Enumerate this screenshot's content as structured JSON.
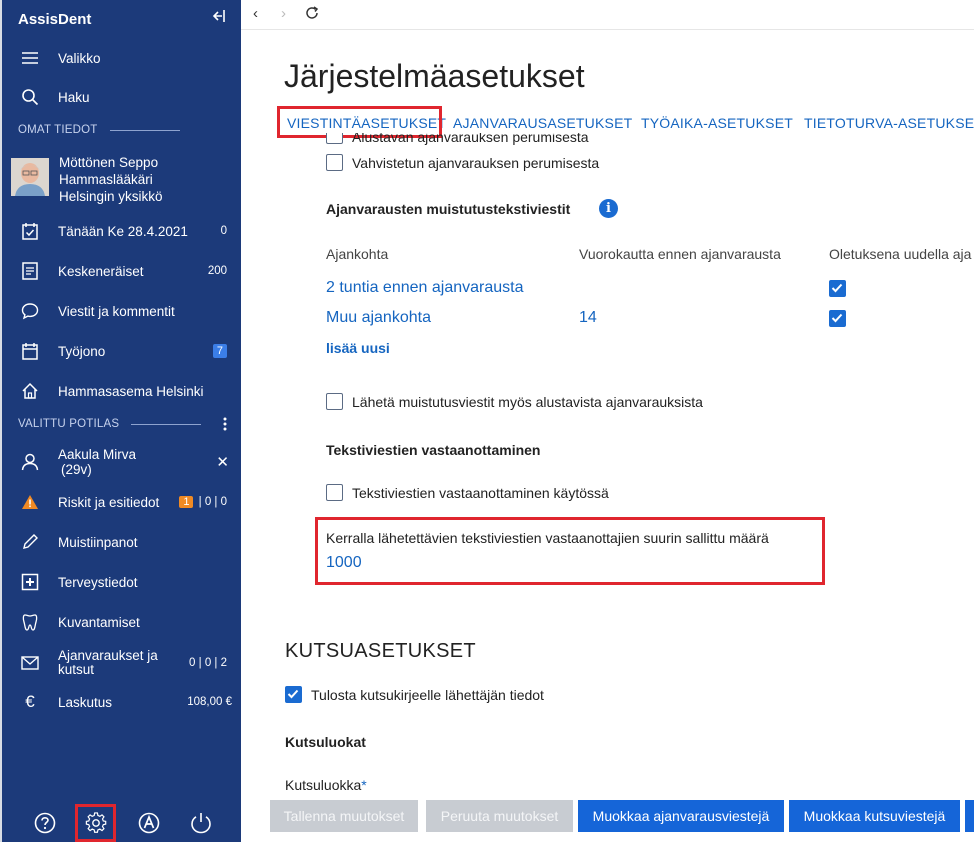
{
  "sidebar": {
    "brand": "AssisDent",
    "menu_label": "Valikko",
    "search_label": "Haku",
    "own_section": "OMAT TIEDOT",
    "profile": {
      "name": "Möttönen Seppo",
      "role": "Hammaslääkäri",
      "unit": "Helsingin yksikkö"
    },
    "items": [
      {
        "label": "Tänään Ke 28.4.2021",
        "count": "0"
      },
      {
        "label": "Keskeneräiset",
        "count": "200"
      },
      {
        "label": "Viestit ja kommentit",
        "count": ""
      },
      {
        "label": "Työjono",
        "count": "7"
      },
      {
        "label": "Hammasasema Helsinki",
        "count": ""
      }
    ],
    "patient_section": "VALITTU POTILAS",
    "patient": {
      "name": "Aakula Mirva",
      "age": "(29v)"
    },
    "patient_items": [
      {
        "label": "Riskit ja esitiedot",
        "badge": "1",
        "count": "| 0 | 0"
      },
      {
        "label": "Muistiinpanot",
        "count": ""
      },
      {
        "label": "Terveystiedot",
        "count": ""
      },
      {
        "label": "Kuvantamiset",
        "count": ""
      },
      {
        "label": "Ajanvaraukset ja kutsut",
        "count": "0 | 0 | 2"
      },
      {
        "label": "Laskutus",
        "count": "108,00 €"
      }
    ],
    "bottom_icons": [
      "help-icon",
      "settings-icon",
      "accessibility-icon",
      "power-icon"
    ]
  },
  "main": {
    "title": "Järjestelmäasetukset",
    "tabs": [
      "VIESTINTÄASETUKSET",
      "AJANVARAUSASETUKSET",
      "TYÖAIKA-ASETUKSET",
      "TIETOTURVA-ASETUKSET"
    ],
    "cancel_checkboxes": [
      {
        "label": "Alustavan ajanvarauksen perumisesta",
        "checked": false
      },
      {
        "label": "Vahvistetun ajanvarauksen perumisesta",
        "checked": false
      }
    ],
    "reminders": {
      "heading": "Ajanvarausten muistutustekstiviestit",
      "columns": [
        "Ajankohta",
        "Vuorokautta ennen ajanvarausta",
        "Oletuksena uudella aja"
      ],
      "rows": [
        {
          "when": "2 tuntia ennen ajanvarausta",
          "days": "",
          "default": true
        },
        {
          "when": "Muu ajankohta",
          "days": "14",
          "default": true
        }
      ],
      "add_new": "lisää uusi",
      "also_preliminary": "Lähetä muistutusviestit myös alustavista ajanvarauksista"
    },
    "receiving": {
      "heading": "Tekstiviestien vastaanottaminen",
      "enabled_label": "Tekstiviestien vastaanottaminen käytössä",
      "max_label": "Kerralla lähetettävien tekstiviestien vastaanottajien suurin sallittu määrä",
      "max_value": "1000"
    },
    "invitations": {
      "heading": "KUTSUASETUKSET",
      "print_sender": "Tulosta kutsukirjeelle lähettäjän tiedot",
      "classes_heading": "Kutsuluokat",
      "class_label": "Kutsuluokka",
      "required_mark": "*"
    },
    "buttons": {
      "save": "Tallenna muutokset",
      "cancel": "Peruuta muutokset",
      "edit_booking_msgs": "Muokkaa ajanvarausviestejä",
      "edit_invite_msgs": "Muokkaa kutsuviestejä"
    }
  },
  "colors": {
    "sidebar": "#1c3a7a",
    "accent": "#1565d8",
    "highlight": "#e0262e"
  }
}
